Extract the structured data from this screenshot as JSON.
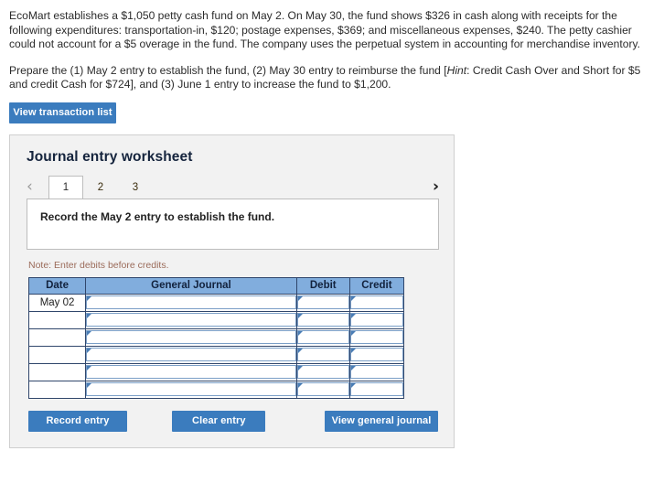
{
  "problem": {
    "paragraph1_part1": "EcoMart establishes a $1,050 petty cash fund on May 2. On May 30, the fund shows $326 in cash along with receipts for the following expenditures: transportation-in, $120; postage expenses, $369; and miscellaneous expenses, $240. The petty cashier could not account for a $5 overage in the fund. The company uses the perpetual system in accounting for merchandise inventory.",
    "paragraph2_part1": "Prepare the (1) May 2 entry to establish the fund, (2) May 30 entry to reimburse the fund [",
    "paragraph2_hint": "Hint",
    "paragraph2_part2": ": Credit Cash Over and Short for $5 and credit Cash for $724], and (3) June 1 entry to increase the fund to $1,200."
  },
  "toolbar": {
    "view_transaction_list_label": "View transaction list"
  },
  "worksheet": {
    "title": "Journal entry worksheet",
    "prev_arrow": "‹",
    "next_arrow": "›",
    "tabs": [
      {
        "label": "1",
        "active": true
      },
      {
        "label": "2",
        "active": false
      },
      {
        "label": "3",
        "active": false
      }
    ],
    "instruction": "Record the May 2 entry to establish the fund.",
    "note": "Note: Enter debits before credits."
  },
  "journal_table": {
    "headers": [
      "Date",
      "General Journal",
      "Debit",
      "Credit"
    ],
    "rows": [
      {
        "date": "May 02",
        "general_journal": "",
        "debit": "",
        "credit": ""
      },
      {
        "date": "",
        "general_journal": "",
        "debit": "",
        "credit": ""
      },
      {
        "date": "",
        "general_journal": "",
        "debit": "",
        "credit": ""
      },
      {
        "date": "",
        "general_journal": "",
        "debit": "",
        "credit": ""
      },
      {
        "date": "",
        "general_journal": "",
        "debit": "",
        "credit": ""
      },
      {
        "date": "",
        "general_journal": "",
        "debit": "",
        "credit": ""
      }
    ]
  },
  "actions": {
    "record_entry_label": "Record entry",
    "clear_entry_label": "Clear entry",
    "view_general_journal_label": "View general journal"
  },
  "colors": {
    "button_blue": "#3b7cbe",
    "table_header_blue": "#81addd",
    "table_border": "#30466b",
    "card_background": "#f2f2f2",
    "note_text": "#9b6b5a",
    "field_border": "#7b9fc7"
  }
}
